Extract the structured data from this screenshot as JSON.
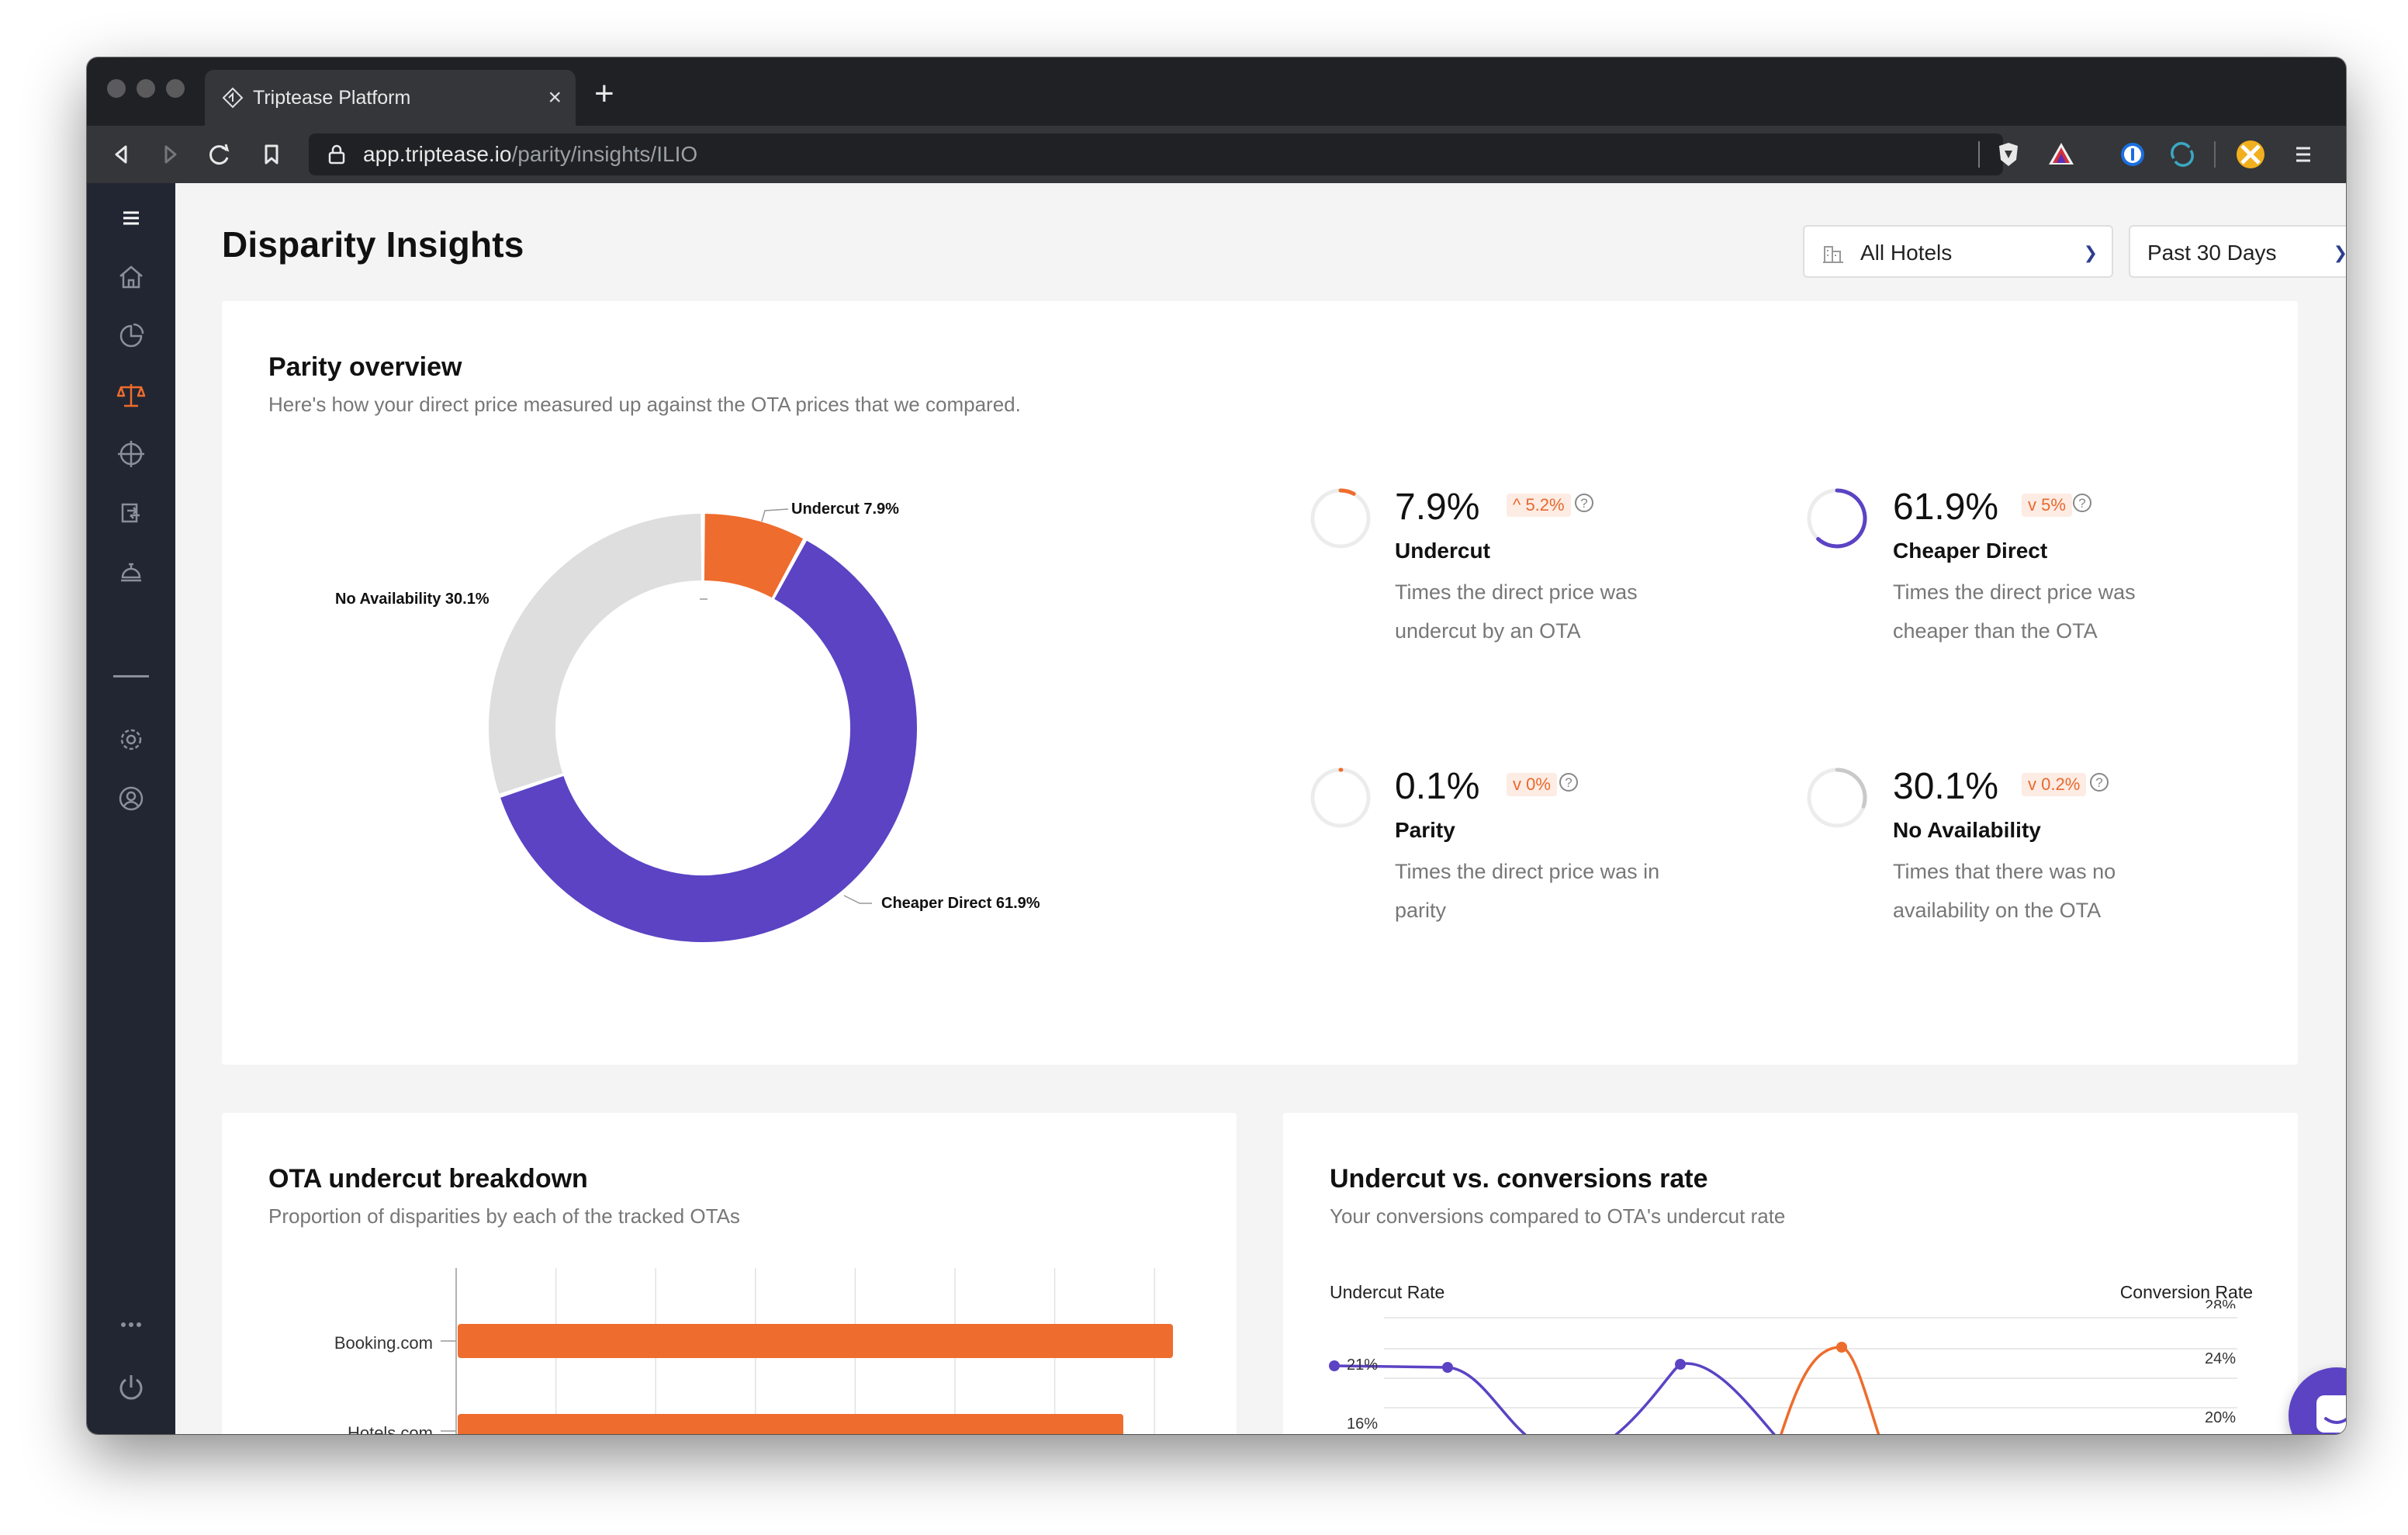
{
  "browser": {
    "tab_title": "Triptease Platform",
    "url_domain": "app.triptease.io",
    "url_path": "/parity/insights/ILIO"
  },
  "page": {
    "title": "Disparity Insights",
    "hotel_select": "All Hotels",
    "period_select": "Past 30 Days"
  },
  "parity": {
    "title": "Parity overview",
    "subtitle": "Here's how your direct price measured up against the OTA prices that we compared.",
    "segments": [
      {
        "name": "Undercut",
        "label": "Undercut 7.9%",
        "value": 7.9,
        "color": "#ee6c2d"
      },
      {
        "name": "Cheaper Direct",
        "label": "Cheaper Direct 61.9%",
        "value": 61.9,
        "color": "#5b43c4"
      },
      {
        "name": "No Availability",
        "label": "No Availability 30.1%",
        "value": 30.1,
        "color": "#dedede"
      }
    ],
    "stats": [
      {
        "value": "7.9%",
        "change": "5.2%",
        "direction": "up",
        "label": "Undercut",
        "desc_line1": "Times the direct price was",
        "desc_line2": "undercut by an OTA",
        "fraction": 0.079,
        "color": "#ee6c2d"
      },
      {
        "value": "61.9%",
        "change": "5%",
        "direction": "down",
        "label": "Cheaper Direct",
        "desc_line1": "Times the direct price was",
        "desc_line2": "cheaper than the OTA",
        "fraction": 0.619,
        "color": "#5b43c4"
      },
      {
        "value": "0.1%",
        "change": "0%",
        "direction": "down",
        "label": "Parity",
        "desc_line1": "Times the direct price was in",
        "desc_line2": "parity",
        "fraction": 0.001,
        "color": "#ee6c2d"
      },
      {
        "value": "30.1%",
        "change": "0.2%",
        "direction": "down",
        "label": "No Availability",
        "desc_line1": "Times that there was no",
        "desc_line2": "availability on the OTA",
        "fraction": 0.301,
        "color": "#c9c9c9"
      }
    ]
  },
  "ota_breakdown": {
    "title": "OTA undercut breakdown",
    "subtitle": "Proportion of disparities by each of the tracked OTAs",
    "bars": [
      {
        "label": "Booking.com"
      },
      {
        "label": "Hotels.com"
      }
    ]
  },
  "conversions": {
    "title": "Undercut vs. conversions rate",
    "subtitle": "Your conversions compared to OTA's undercut rate",
    "y_left_title": "Undercut Rate",
    "y_right_title": "Conversion Rate",
    "left_ticks": [
      "21%",
      "16%"
    ],
    "right_ticks": [
      "28%",
      "24%",
      "20%"
    ]
  },
  "chart_data": [
    {
      "type": "pie",
      "title": "Parity overview",
      "categories": [
        "Undercut",
        "Cheaper Direct",
        "Parity",
        "No Availability"
      ],
      "values": [
        7.9,
        61.9,
        0.1,
        30.1
      ]
    },
    {
      "type": "bar",
      "title": "OTA undercut breakdown",
      "categories": [
        "Booking.com",
        "Hotels.com"
      ],
      "values": [
        0.72,
        0.67
      ]
    }
  ]
}
